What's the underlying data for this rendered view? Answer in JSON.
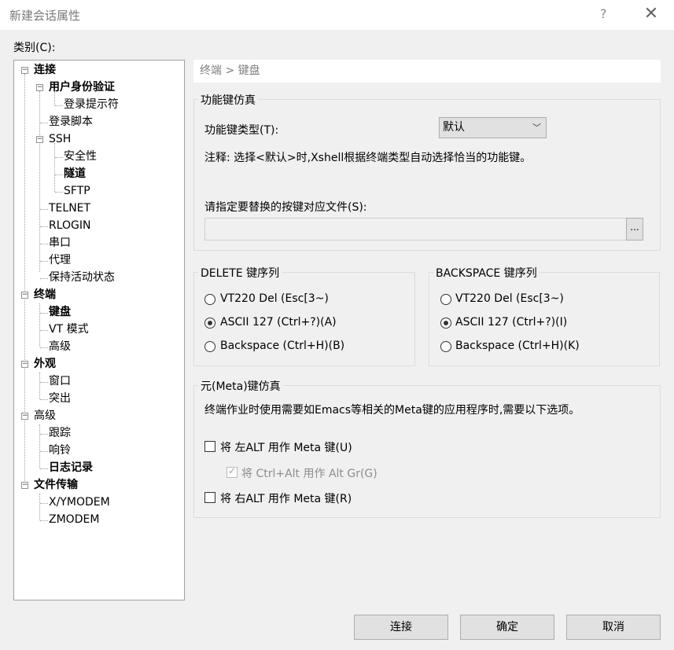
{
  "window": {
    "title": "新建会话属性",
    "help": "?",
    "close": "✕"
  },
  "category_label": "类别(C):",
  "tree": {
    "connection": "连接",
    "auth": "用户身份验证",
    "login_prompts": "登录提示符",
    "login_scripts": "登录脚本",
    "ssh": "SSH",
    "security": "安全性",
    "tunnel": "隧道",
    "sftp": "SFTP",
    "telnet": "TELNET",
    "rlogin": "RLOGIN",
    "serial": "串口",
    "proxy": "代理",
    "keepalive": "保持活动状态",
    "terminal": "终端",
    "keyboard": "键盘",
    "vt_mode": "VT 模式",
    "advanced_t": "高级",
    "appearance": "外观",
    "window": "窗口",
    "highlight": "突出",
    "advanced": "高级",
    "tracking": "跟踪",
    "bell": "响铃",
    "logging": "日志记录",
    "file_transfer": "文件传输",
    "xymodem": "X/YMODEM",
    "zmodem": "ZMODEM"
  },
  "breadcrumb": "终端 > 键盘",
  "function_keys": {
    "group": "功能键仿真",
    "type_label": "功能键类型(T):",
    "type_value": "默认",
    "note": "注释: 选择<默认>时,Xshell根据终端类型自动选择恰当的功能键。",
    "file_label": "请指定要替换的按键对应文件(S):",
    "file_value": "",
    "browse": "..."
  },
  "delete_seq": {
    "group": "DELETE 键序列",
    "options": [
      "VT220 Del (Esc[3~)",
      "ASCII 127 (Ctrl+?)(A)",
      "Backspace (Ctrl+H)(B)"
    ],
    "selected_index": 1
  },
  "backspace_seq": {
    "group": "BACKSPACE 键序列",
    "options": [
      "VT220 Del (Esc[3~)",
      "ASCII 127 (Ctrl+?)(I)",
      "Backspace (Ctrl+H)(K)"
    ],
    "selected_index": 1
  },
  "meta": {
    "group": "元(Meta)键仿真",
    "desc": "终端作业时使用需要如Emacs等相关的Meta键的应用程序时,需要以下选项。",
    "left_alt": "将 左ALT 用作 Meta 键(U)",
    "altgr": "将 Ctrl+Alt 用作 Alt Gr(G)",
    "right_alt": "将 右ALT 用作 Meta 键(R)",
    "left_alt_checked": false,
    "altgr_checked": true,
    "right_alt_checked": false
  },
  "buttons": {
    "connect": "连接",
    "ok": "确定",
    "cancel": "取消"
  }
}
